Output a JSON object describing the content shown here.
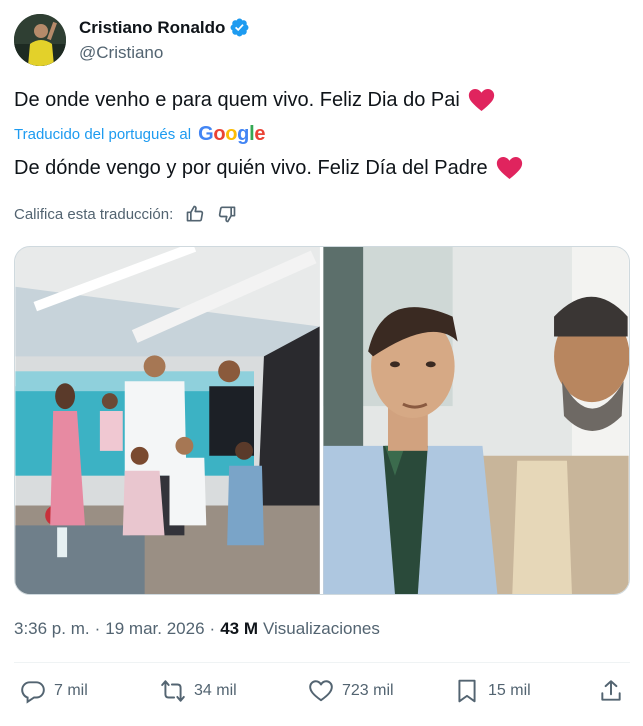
{
  "author": {
    "display_name": "Cristiano Ronaldo",
    "handle": "@Cristiano",
    "verified_icon": "verified-badge-icon"
  },
  "tweet": {
    "original_text": "De onde venho e para quem vivo. Feliz Dia do Pai",
    "translated_by": "Traducido del portugués al",
    "translator_brand": "Google",
    "translated_text": "De dónde vengo y por quién vivo. Feliz Día del Padre",
    "rate_translation": "Califica esta traducción:",
    "emoji": "heart-icon"
  },
  "meta": {
    "time": "3:36 p. m.",
    "date": "19 mar. 2026",
    "views_count": "43 M",
    "views_label": "Visualizaciones"
  },
  "actions": {
    "replies": "7 mil",
    "reposts": "34 mil",
    "likes": "723 mil",
    "bookmarks": "15 mil"
  },
  "colors": {
    "accent": "#1d9bf0",
    "text": "#0f1419",
    "secondary": "#536471",
    "heart": "#e0245e"
  }
}
